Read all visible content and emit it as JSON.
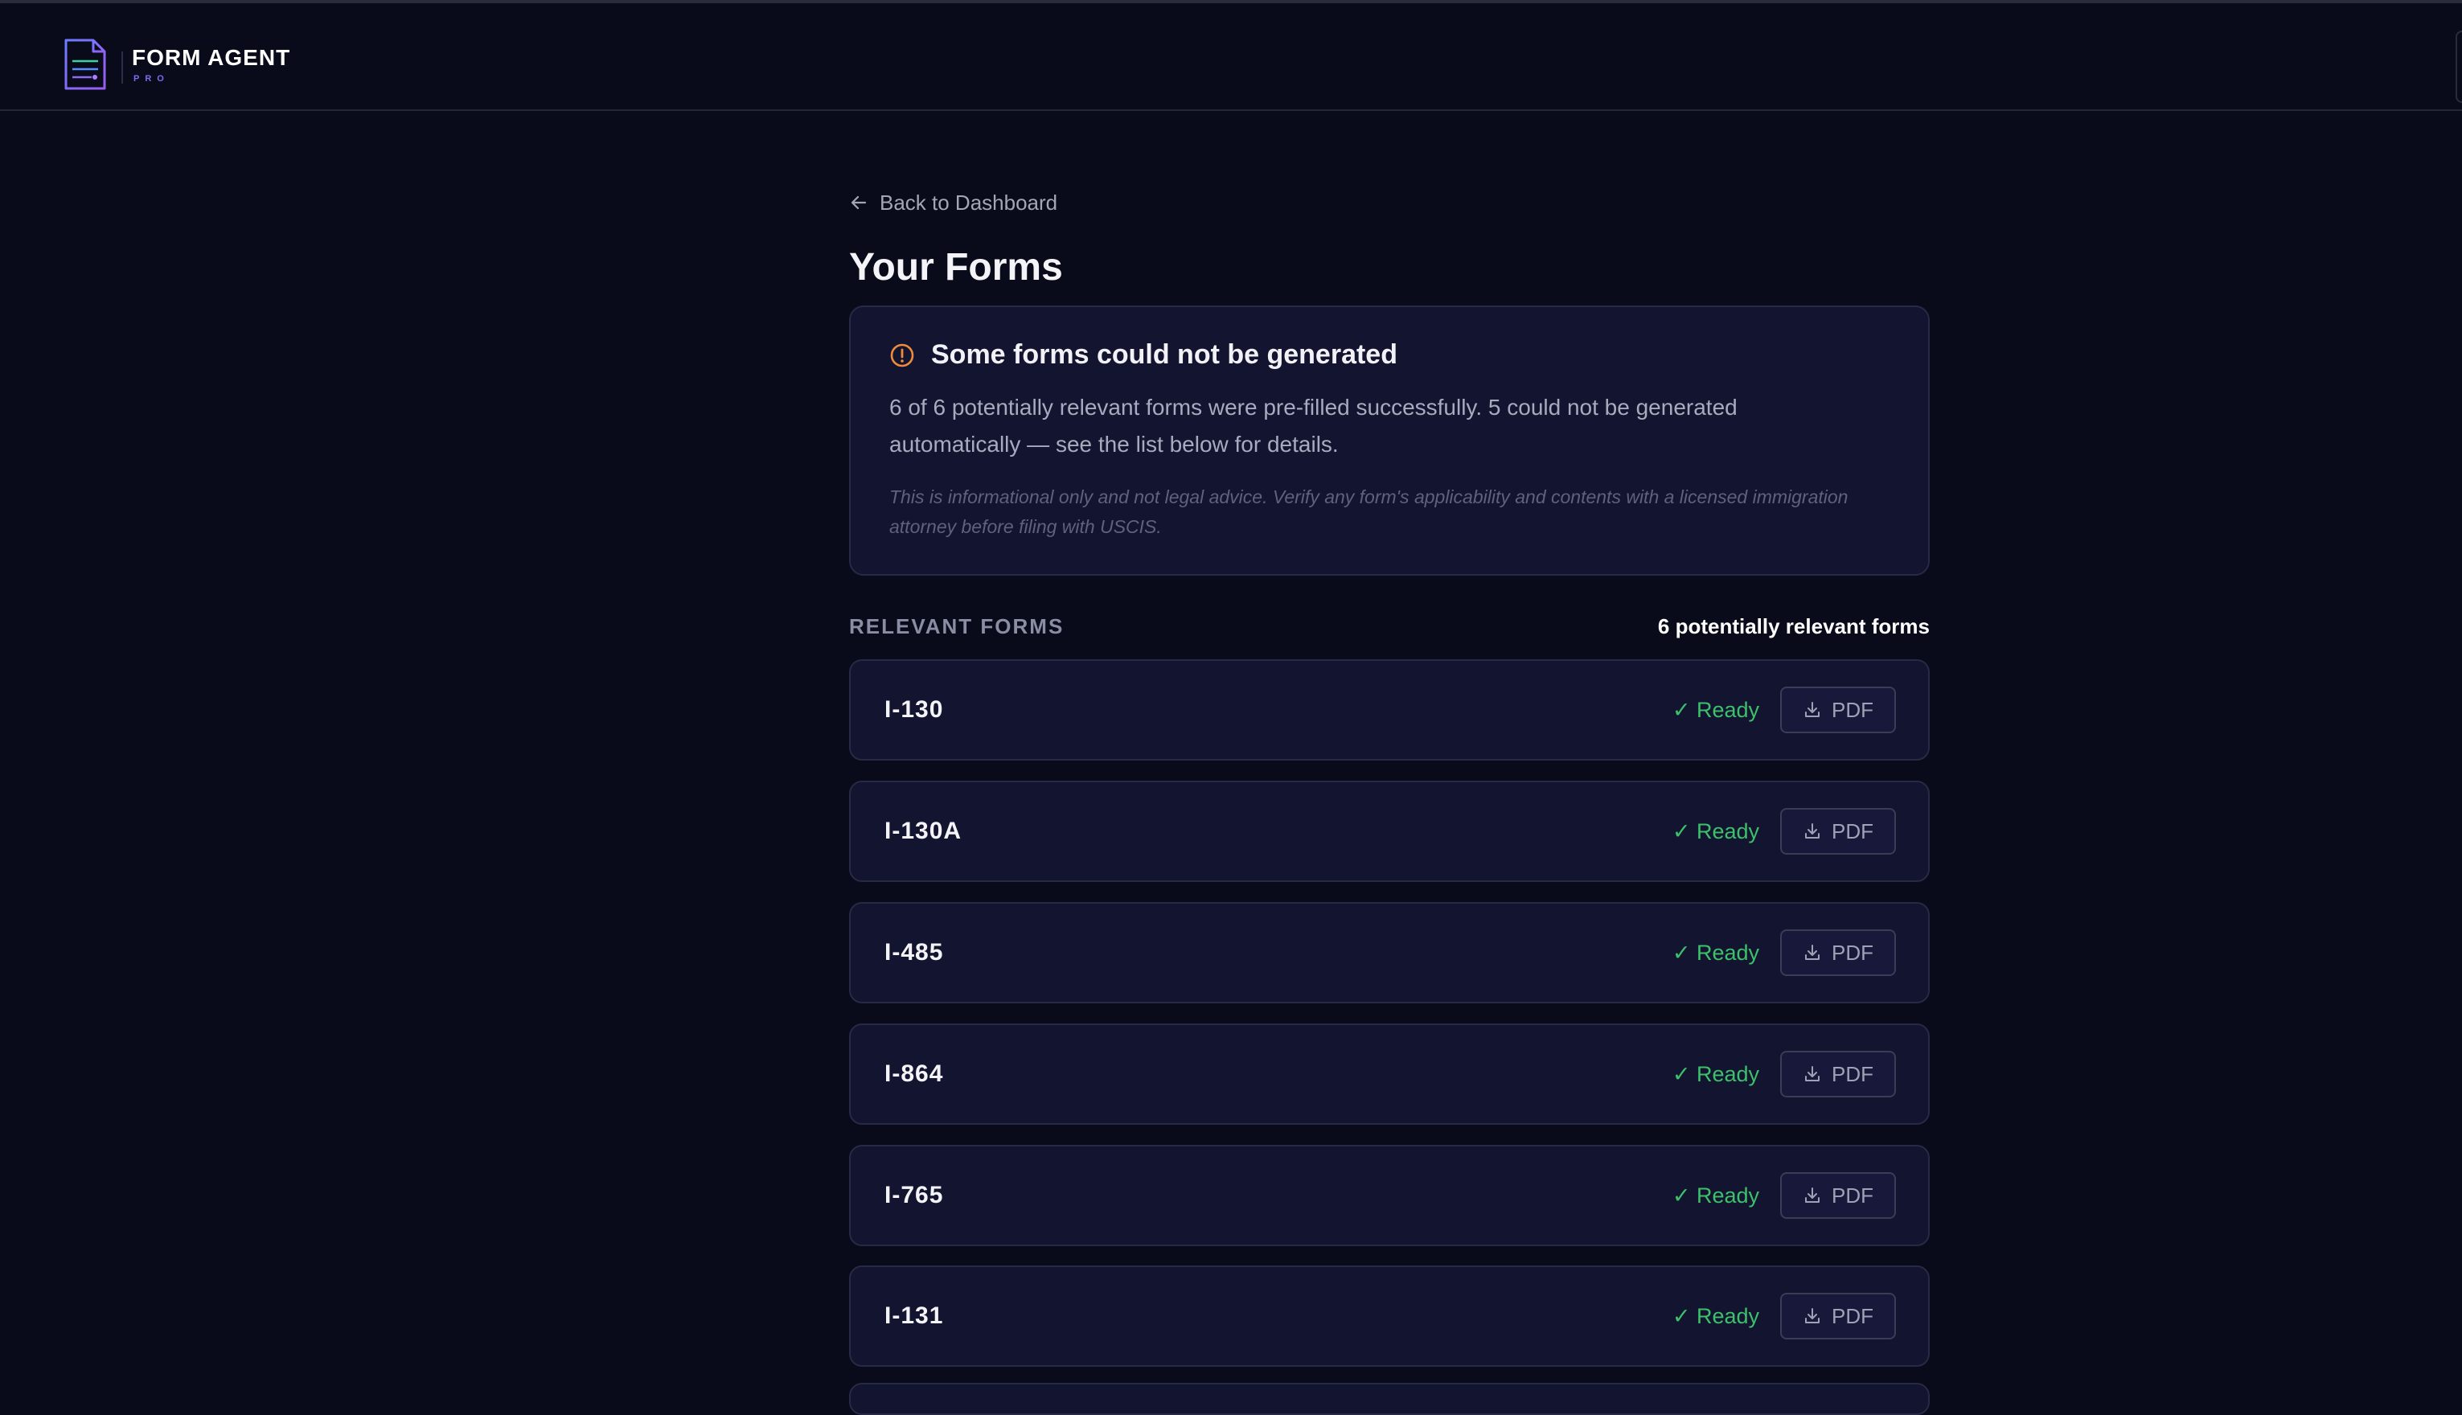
{
  "app": {
    "name": "FORM AGENT",
    "tier": "PRO"
  },
  "nav": {
    "back_label": "Back to Dashboard"
  },
  "page": {
    "title": "Your Forms"
  },
  "alert": {
    "title": "Some forms could not be generated",
    "body": "6 of 6 potentially relevant forms were pre-filled successfully. 5 could not be generated automatically — see the list below for details.",
    "disclaimer": "This is informational only and not legal advice. Verify any form's applicability and contents with a licensed immigration attorney before filing with USCIS."
  },
  "section": {
    "label": "RELEVANT FORMS",
    "count_label": "6 potentially relevant forms"
  },
  "forms": [
    {
      "name": "I-130",
      "status": "✓ Ready",
      "action": "PDF"
    },
    {
      "name": "I-130A",
      "status": "✓ Ready",
      "action": "PDF"
    },
    {
      "name": "I-485",
      "status": "✓ Ready",
      "action": "PDF"
    },
    {
      "name": "I-864",
      "status": "✓ Ready",
      "action": "PDF"
    },
    {
      "name": "I-765",
      "status": "✓ Ready",
      "action": "PDF"
    },
    {
      "name": "I-131",
      "status": "✓ Ready",
      "action": "PDF"
    }
  ],
  "colors": {
    "background": "#090a1a",
    "card": "#131430",
    "ready": "#3cc16a",
    "warning": "#f08a3c",
    "brand_accent": "#7b6cf0"
  }
}
